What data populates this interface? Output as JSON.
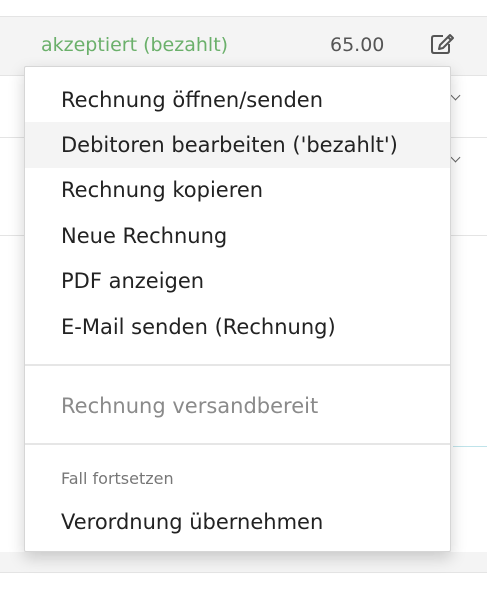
{
  "invoice_row": {
    "status": "akzeptiert (bezahlt)",
    "status_color": "#6bb06b",
    "amount": "65.00",
    "edit_icon": "edit-icon"
  },
  "menu": {
    "items": [
      {
        "label": "Rechnung öffnen/senden",
        "state": "normal"
      },
      {
        "label": "Debitoren bearbeiten ('bezahlt')",
        "state": "hover"
      },
      {
        "label": "Rechnung kopieren",
        "state": "normal"
      },
      {
        "label": "Neue Rechnung",
        "state": "normal"
      },
      {
        "label": "PDF anzeigen",
        "state": "normal"
      },
      {
        "label": "E-Mail senden (Rechnung)",
        "state": "normal"
      }
    ],
    "disabled_item": {
      "label": "Rechnung versandbereit",
      "state": "disabled"
    },
    "section": {
      "title": "Fall fortsetzen",
      "items": [
        {
          "label": "Verordnung übernehmen",
          "state": "normal"
        }
      ]
    }
  }
}
